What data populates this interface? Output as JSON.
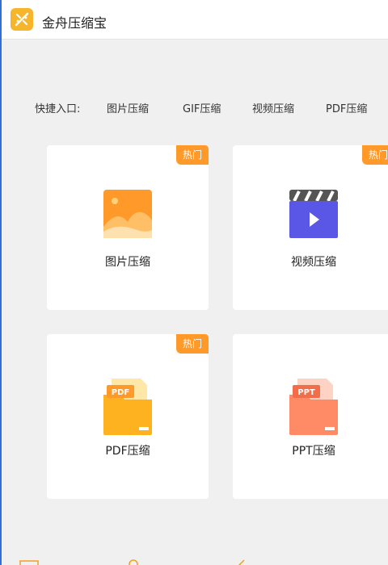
{
  "app": {
    "title": "金舟压缩宝",
    "logo_icon": "compress-logo-icon"
  },
  "quick_access": {
    "label": "快捷入口:",
    "links": [
      "图片压缩",
      "GIF压缩",
      "视频压缩",
      "PDF压缩"
    ]
  },
  "cards": [
    {
      "label": "图片压缩",
      "badge": "热门",
      "icon": "image-icon"
    },
    {
      "label": "视频压缩",
      "badge": "热门",
      "icon": "video-icon"
    },
    {
      "label": "PDF压缩",
      "badge": "热门",
      "icon": "pdf-folder-icon",
      "icon_tag": "PDF"
    },
    {
      "label": "PPT压缩",
      "badge": "",
      "icon": "ppt-folder-icon",
      "icon_tag": "PPT"
    }
  ],
  "colors": {
    "accent_orange": "#ff9a2a",
    "video_purple": "#5a57e6",
    "ppt_coral": "#ff7f5c",
    "pdf_amber": "#ffb21f"
  }
}
